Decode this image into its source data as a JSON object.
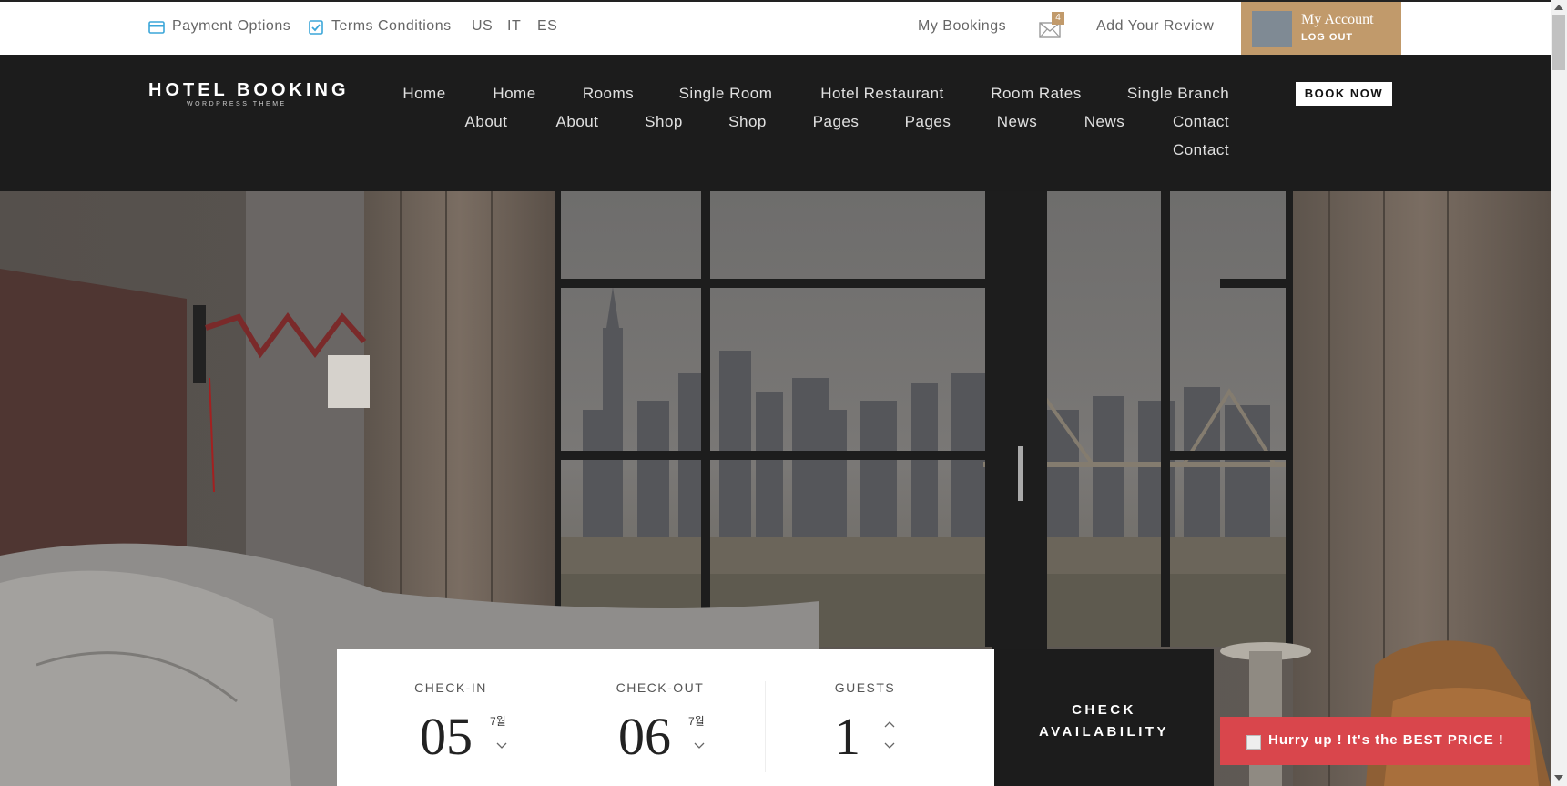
{
  "topbar": {
    "payment_options": "Payment Options",
    "terms_conditions": "Terms Conditions",
    "lang_us": "US",
    "lang_it": "IT",
    "lang_es": "ES",
    "my_bookings": "My Bookings",
    "mail_count": "4",
    "add_review": "Add Your Review",
    "account_name": "My Account",
    "account_logout": "LOG OUT"
  },
  "header": {
    "logo_title": "HOTEL BOOKING",
    "logo_subtitle": "WORDPRESS THEME",
    "book_now": "BOOK NOW",
    "nav_row1": [
      "Home",
      "Home",
      "Rooms",
      "Single Room",
      "Hotel Restaurant",
      "Room Rates",
      "Single Branch"
    ],
    "nav_row2": [
      "About",
      "About",
      "Shop",
      "Shop",
      "Pages",
      "Pages",
      "News",
      "News",
      "Contact"
    ],
    "nav_row3": [
      "Contact"
    ]
  },
  "booking": {
    "checkin_label": "CHECK-IN",
    "checkin_day": "05",
    "checkin_month": "7월",
    "checkout_label": "CHECK-OUT",
    "checkout_day": "06",
    "checkout_month": "7월",
    "guests_label": "GUESTS",
    "guests_value": "1",
    "check_line1": "CHECK",
    "check_line2": "AVAILABILITY"
  },
  "promo": {
    "text": "Hurry up ! It's the BEST PRICE !"
  },
  "colors": {
    "accent": "#c19a6b",
    "header_bg": "#1c1c1c",
    "promo": "#d9464c",
    "icon_blue": "#3ba6d9"
  }
}
